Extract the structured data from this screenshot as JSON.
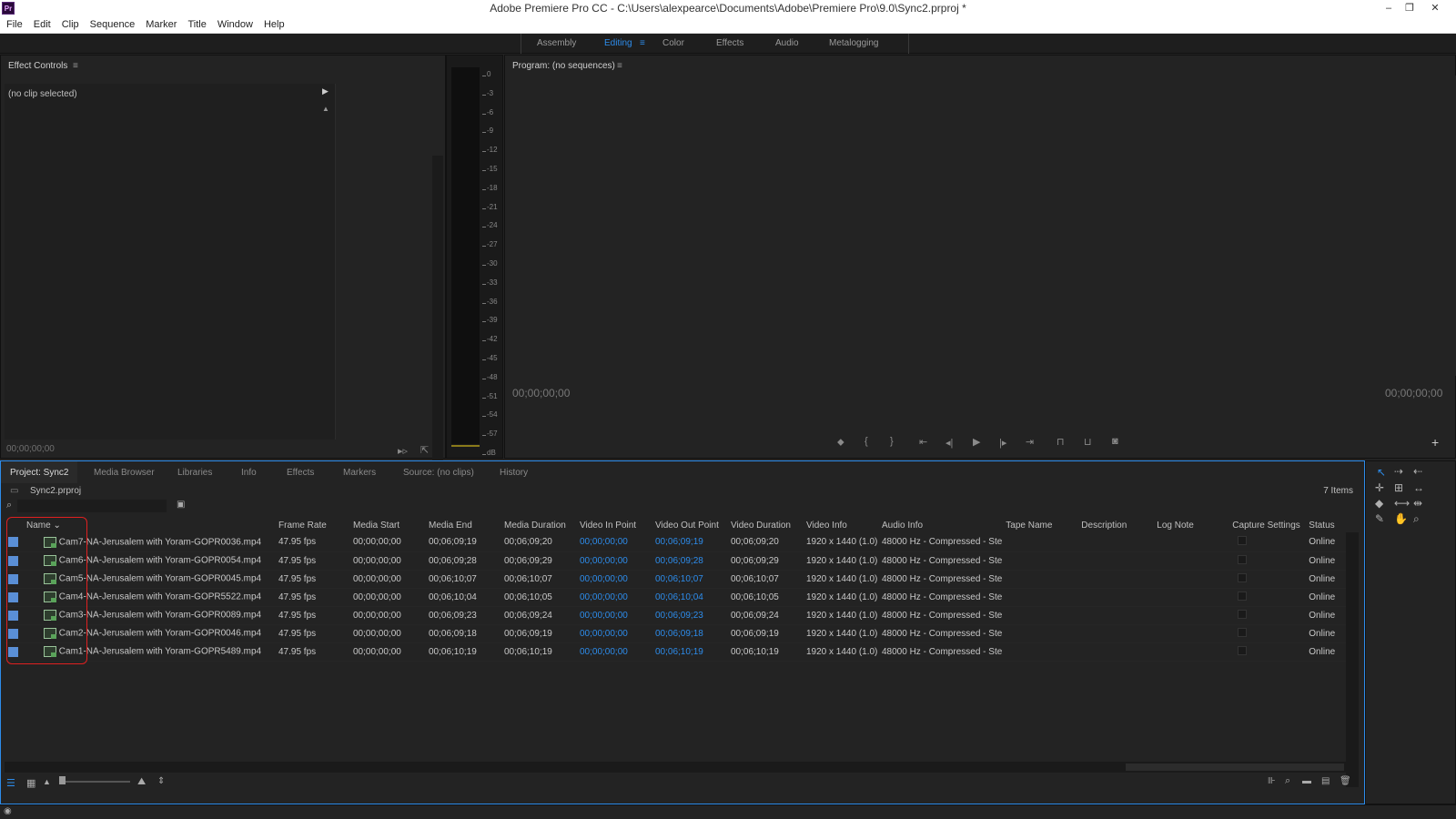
{
  "titlebar": {
    "app_icon": "Pr",
    "title": "Adobe Premiere Pro CC - C:\\Users\\alexpearce\\Documents\\Adobe\\Premiere Pro\\9.0\\Sync2.prproj *",
    "minimize_glyph": "‒",
    "restore_glyph": "❐",
    "close_glyph": "✕"
  },
  "menu": [
    "File",
    "Edit",
    "Clip",
    "Sequence",
    "Marker",
    "Title",
    "Window",
    "Help"
  ],
  "workspaces": {
    "items": [
      "Assembly",
      "Editing",
      "Color",
      "Effects",
      "Audio",
      "Metalogging"
    ],
    "active": "Editing",
    "menu_glyph": "≡"
  },
  "effect_controls": {
    "title": "Effect Controls",
    "menu_glyph": "≡",
    "no_clip": "(no clip selected)",
    "timecode": "00;00;00;00"
  },
  "audio_meter": {
    "ticks": [
      "0",
      "-3",
      "-6",
      "-9",
      "-12",
      "-15",
      "-18",
      "-21",
      "-24",
      "-27",
      "-30",
      "-33",
      "-36",
      "-39",
      "-42",
      "-45",
      "-48",
      "-51",
      "-54",
      "-57",
      "dB"
    ]
  },
  "program_monitor": {
    "title": "Program: (no sequences)",
    "menu_glyph": "≡",
    "timecode_left": "00;00;00;00",
    "timecode_right": "00;00;00;00",
    "add_glyph": "+"
  },
  "bottom_tabs": [
    "Project: Sync2",
    "Media Browser",
    "Libraries",
    "Info",
    "Effects",
    "Markers",
    "Source: (no clips)",
    "History"
  ],
  "project": {
    "file": "Sync2.prproj",
    "item_count": "7 Items",
    "search_placeholder": "",
    "columns": [
      "Name",
      "Frame Rate",
      "Media Start",
      "Media End",
      "Media Duration",
      "Video In Point",
      "Video Out Point",
      "Video Duration",
      "Video Info",
      "Audio Info",
      "Tape Name",
      "Description",
      "Log Note",
      "Capture Settings",
      "Status"
    ],
    "rows": [
      {
        "name": "Cam7-NA-Jerusalem with Yoram-GOPR0036.mp4",
        "frame_rate": "47.95 fps",
        "media_start": "00;00;00;00",
        "media_end": "00;06;09;19",
        "media_duration": "00;06;09;20",
        "video_in": "00;00;00;00",
        "video_out": "00;06;09;19",
        "video_duration": "00;06;09;20",
        "video_info": "1920 x 1440 (1.0)",
        "audio_info": "48000 Hz - Compressed - Ste",
        "status": "Online"
      },
      {
        "name": "Cam6-NA-Jerusalem with Yoram-GOPR0054.mp4",
        "frame_rate": "47.95 fps",
        "media_start": "00;00;00;00",
        "media_end": "00;06;09;28",
        "media_duration": "00;06;09;29",
        "video_in": "00;00;00;00",
        "video_out": "00;06;09;28",
        "video_duration": "00;06;09;29",
        "video_info": "1920 x 1440 (1.0)",
        "audio_info": "48000 Hz - Compressed - Ste",
        "status": "Online"
      },
      {
        "name": "Cam5-NA-Jerusalem with Yoram-GOPR0045.mp4",
        "frame_rate": "47.95 fps",
        "media_start": "00;00;00;00",
        "media_end": "00;06;10;07",
        "media_duration": "00;06;10;07",
        "video_in": "00;00;00;00",
        "video_out": "00;06;10;07",
        "video_duration": "00;06;10;07",
        "video_info": "1920 x 1440 (1.0)",
        "audio_info": "48000 Hz - Compressed - Ste",
        "status": "Online"
      },
      {
        "name": "Cam4-NA-Jerusalem with Yoram-GOPR5522.mp4",
        "frame_rate": "47.95 fps",
        "media_start": "00;00;00;00",
        "media_end": "00;06;10;04",
        "media_duration": "00;06;10;05",
        "video_in": "00;00;00;00",
        "video_out": "00;06;10;04",
        "video_duration": "00;06;10;05",
        "video_info": "1920 x 1440 (1.0)",
        "audio_info": "48000 Hz - Compressed - Ste",
        "status": "Online"
      },
      {
        "name": "Cam3-NA-Jerusalem with Yoram-GOPR0089.mp4",
        "frame_rate": "47.95 fps",
        "media_start": "00;00;00;00",
        "media_end": "00;06;09;23",
        "media_duration": "00;06;09;24",
        "video_in": "00;00;00;00",
        "video_out": "00;06;09;23",
        "video_duration": "00;06;09;24",
        "video_info": "1920 x 1440 (1.0)",
        "audio_info": "48000 Hz - Compressed - Ste",
        "status": "Online"
      },
      {
        "name": "Cam2-NA-Jerusalem with Yoram-GOPR0046.mp4",
        "frame_rate": "47.95 fps",
        "media_start": "00;00;00;00",
        "media_end": "00;06;09;18",
        "media_duration": "00;06;09;19",
        "video_in": "00;00;00;00",
        "video_out": "00;06;09;18",
        "video_duration": "00;06;09;19",
        "video_info": "1920 x 1440 (1.0)",
        "audio_info": "48000 Hz - Compressed - Ste",
        "status": "Online"
      },
      {
        "name": "Cam1-NA-Jerusalem with Yoram-GOPR5489.mp4",
        "frame_rate": "47.95 fps",
        "media_start": "00;00;00;00",
        "media_end": "00;06;10;19",
        "media_duration": "00;06;10;19",
        "video_in": "00;00;00;00",
        "video_out": "00;06;10;19",
        "video_duration": "00;06;10;19",
        "video_info": "1920 x 1440 (1.0)",
        "audio_info": "48000 Hz - Compressed - Ste",
        "status": "Online"
      }
    ]
  },
  "colors": {
    "accent": "#2d8ceb",
    "label_swatch": "#5a8fd6",
    "annotation": "#e02020"
  }
}
